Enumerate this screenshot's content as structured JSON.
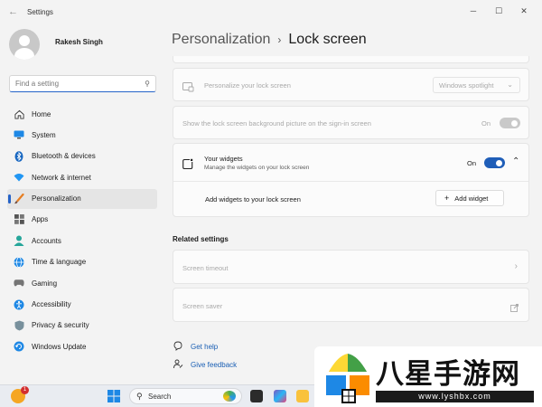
{
  "window": {
    "title": "Settings",
    "controls": {
      "minimize": "─",
      "maximize": "☐",
      "close": "✕"
    }
  },
  "profile": {
    "name": "Rakesh Singh"
  },
  "search": {
    "placeholder": "Find a setting"
  },
  "nav": {
    "items": [
      {
        "label": "Home",
        "icon": "home-icon",
        "active": false
      },
      {
        "label": "System",
        "icon": "system-icon",
        "active": false
      },
      {
        "label": "Bluetooth & devices",
        "icon": "bluetooth-icon",
        "active": false
      },
      {
        "label": "Network & internet",
        "icon": "network-icon",
        "active": false
      },
      {
        "label": "Personalization",
        "icon": "brush-icon",
        "active": true
      },
      {
        "label": "Apps",
        "icon": "apps-icon",
        "active": false
      },
      {
        "label": "Accounts",
        "icon": "accounts-icon",
        "active": false
      },
      {
        "label": "Time & language",
        "icon": "globe-icon",
        "active": false
      },
      {
        "label": "Gaming",
        "icon": "gaming-icon",
        "active": false
      },
      {
        "label": "Accessibility",
        "icon": "accessibility-icon",
        "active": false
      },
      {
        "label": "Privacy & security",
        "icon": "shield-icon",
        "active": false
      },
      {
        "label": "Windows Update",
        "icon": "update-icon",
        "active": false
      }
    ]
  },
  "breadcrumb": {
    "parent": "Personalization",
    "separator": "›",
    "current": "Lock screen"
  },
  "lock_screen": {
    "personalize": {
      "label": "Personalize your lock screen",
      "value": "Windows spotlight"
    },
    "background_on_signin": {
      "label": "Show the lock screen background picture on the sign-in screen",
      "state": "On"
    },
    "widgets": {
      "title": "Your widgets",
      "subtitle": "Manage the widgets on your lock screen",
      "state": "On",
      "add_label": "Add widgets to your lock screen",
      "add_button": "Add widget"
    }
  },
  "related": {
    "title": "Related settings",
    "items": [
      {
        "label": "Screen timeout"
      },
      {
        "label": "Screen saver"
      }
    ]
  },
  "help": {
    "get_help": "Get help",
    "feedback": "Give feedback"
  },
  "taskbar": {
    "search_label": "Search",
    "badge": "1"
  },
  "watermark": {
    "text": "八星手游网",
    "url": "www.lyshbx.com"
  },
  "colors": {
    "accent": "#2563c8",
    "sidebar_active_bg": "#e5e5e5",
    "link": "#1a5fb4"
  }
}
